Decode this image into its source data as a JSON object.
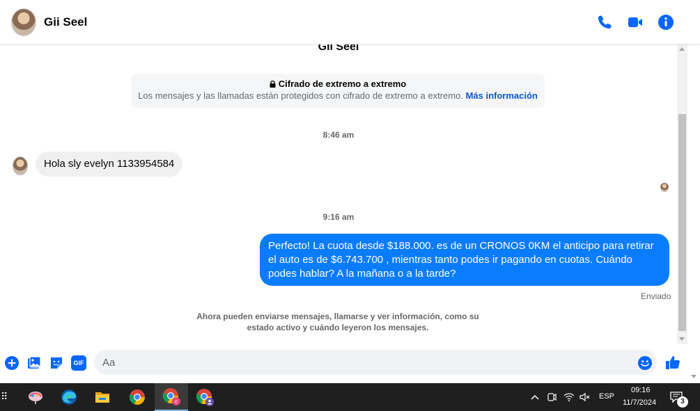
{
  "header": {
    "contact_name": "Gii Seel",
    "icons": [
      "phone-icon",
      "video-icon",
      "info-icon"
    ]
  },
  "chat": {
    "title_peek": "Gii Seel",
    "encryption": {
      "title": "Cifrado de extremo a extremo",
      "text": "Los mensajes y las llamadas están protegidos con cifrado de extremo a extremo.",
      "link": "Más información"
    },
    "messages": [
      {
        "timestamp": "8:46 am",
        "direction": "incoming",
        "text": "Hola sly evelyn 1133954584"
      },
      {
        "timestamp": "9:16 am",
        "direction": "outgoing",
        "text": "Perfecto! La cuota desde $188.000. es de un CRONOS 0KM el anticipo para retirar el auto es de $6.743.700 , mientras tanto podes ir pagando en cuotas. Cuándo podes hablar? A la mañana o a la tarde?",
        "status": "Enviado"
      }
    ],
    "info_note": "Ahora pueden enviarse mensajes, llamarse y ver información, como su estado activo y cuándo leyeron los mensajes."
  },
  "composer": {
    "placeholder": "Aa",
    "value": "",
    "icons": [
      "plus-icon",
      "photo-icon",
      "sticker-icon",
      "gif-icon",
      "emoji-icon",
      "like-icon"
    ],
    "gif_label": "GIF"
  },
  "taskbar": {
    "apps": [
      "app-launcher-icon",
      "edge-icon",
      "file-explorer-icon",
      "chrome-icon",
      "chrome-profile-c-icon",
      "chrome-profile-2-icon"
    ],
    "language": "ESP",
    "time": "09:16",
    "date": "11/7/2024",
    "notification_count": "3"
  },
  "colors": {
    "accent": "#0a7cff",
    "icon_blue": "#0866ff",
    "incoming_bubble": "#f0f0f0",
    "taskbar": "#1f1f1f"
  }
}
